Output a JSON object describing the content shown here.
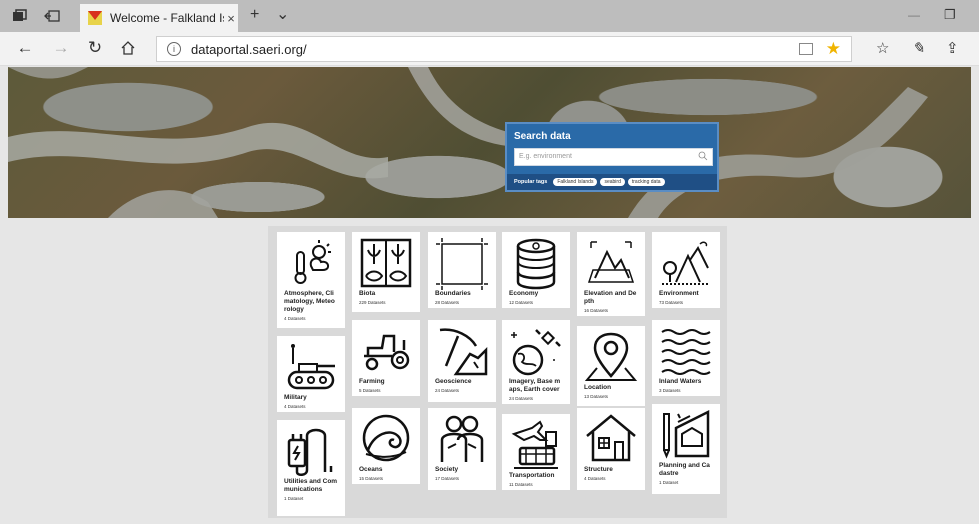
{
  "browser": {
    "tab_title": "Welcome - Falkland Isla",
    "tab_close": "×",
    "new_tab": "+",
    "tab_list": "⌄",
    "minimize": "—",
    "restore": "❐",
    "url": "dataportal.saeri.org/"
  },
  "search": {
    "title": "Search data",
    "placeholder": "E.g. environment",
    "popular_label": "Popular tags",
    "tags": [
      "Falkland Islands",
      "seabird",
      "tracking data"
    ]
  },
  "categories": [
    {
      "name": "Atmosphere, Cli matology, Meteo rology",
      "count": "4 Datasets",
      "icon": "weather-thermometer-icon"
    },
    {
      "name": "Biota",
      "count": "229 Datasets",
      "icon": "plants-fish-icon"
    },
    {
      "name": "Boundaries",
      "count": "28 Datasets",
      "icon": "boundary-square-icon"
    },
    {
      "name": "Economy",
      "count": "12 Datasets",
      "icon": "coins-stack-icon"
    },
    {
      "name": "Elevation and De pth",
      "count": "16 Datasets",
      "icon": "elevation-grid-icon"
    },
    {
      "name": "Environment",
      "count": "73 Datasets",
      "icon": "mountains-tree-icon"
    },
    {
      "name": "Military",
      "count": "4 Datasets",
      "icon": "tank-icon"
    },
    {
      "name": "Farming",
      "count": "5 Datasets",
      "icon": "tractor-icon"
    },
    {
      "name": "Geoscience",
      "count": "24 Datasets",
      "icon": "pickaxe-rock-icon"
    },
    {
      "name": "Imagery, Base m aps, Earth cover",
      "count": "24 Datasets",
      "icon": "satellite-earth-icon"
    },
    {
      "name": "Location",
      "count": "13 Datasets",
      "icon": "location-pin-icon"
    },
    {
      "name": "Inland Waters",
      "count": "3 Datasets",
      "icon": "waves-icon"
    },
    {
      "name": "Utilities and Com munications",
      "count": "1 Dataset",
      "icon": "plug-battery-icon"
    },
    {
      "name": "Oceans",
      "count": "15 Datasets",
      "icon": "ocean-wave-icon"
    },
    {
      "name": "Society",
      "count": "17 Datasets",
      "icon": "people-icon"
    },
    {
      "name": "Transportation",
      "count": "11 Datasets",
      "icon": "plane-train-icon"
    },
    {
      "name": "Structure",
      "count": "4 Datasets",
      "icon": "house-icon"
    },
    {
      "name": "Planning and Ca dastre",
      "count": "1 Dataset",
      "icon": "blueprint-ruler-icon"
    }
  ]
}
